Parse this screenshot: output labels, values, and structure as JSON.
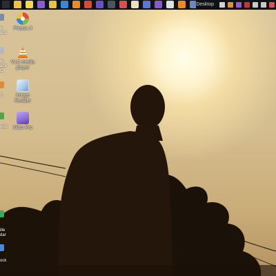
{
  "taskbar": {
    "apps": [
      {
        "icon": "windows-start-icon",
        "color": "#2a2e33"
      },
      {
        "icon": "file-explorer-icon",
        "color": "#f0c040"
      },
      {
        "icon": "sticky-notes-icon",
        "color": "#f7d84a"
      },
      {
        "icon": "visual-studio-icon",
        "color": "#8a5bd6"
      },
      {
        "icon": "chrome-icon",
        "color": "#e9c23a"
      },
      {
        "icon": "defender-shield-icon",
        "color": "#3a86d8"
      },
      {
        "icon": "vlc-icon",
        "color": "#f08a1c"
      },
      {
        "icon": "app-icon",
        "color": "#d64a3a"
      },
      {
        "icon": "media-icon",
        "color": "#6c4bd6"
      },
      {
        "icon": "store-icon",
        "color": "#4a5560"
      },
      {
        "icon": "video-icon",
        "color": "#e64a4a"
      },
      {
        "icon": "messaging-icon",
        "color": "#e8e0c0"
      },
      {
        "icon": "browser-icon",
        "color": "#5b74e0"
      },
      {
        "icon": "photos-icon",
        "color": "#8a58c8"
      },
      {
        "icon": "file-icon",
        "color": "#e0e0e0"
      },
      {
        "icon": "firefox-icon",
        "color": "#ef8a22"
      },
      {
        "icon": "settings-icon",
        "color": "#6a88c8"
      }
    ],
    "desktop_label": "Desktop",
    "tray": [
      {
        "icon": "tray-app-icon",
        "color": "#d0d0d0"
      },
      {
        "icon": "tray-orange-icon",
        "color": "#e09030"
      },
      {
        "icon": "tray-purple-icon",
        "color": "#9b59d0"
      },
      {
        "icon": "tray-red-icon",
        "color": "#d03030"
      },
      {
        "icon": "battery-icon",
        "color": "#c8c8c8"
      },
      {
        "icon": "volume-icon",
        "color": "#c8c8c8"
      },
      {
        "icon": "network-icon",
        "color": "#e05050"
      }
    ]
  },
  "desktop": {
    "icons": [
      {
        "label": "Picasa 3",
        "icon": "picasa-icon",
        "color": "#7bbf3a"
      },
      {
        "label": "VLC media player",
        "icon": "vlc-media-player-icon",
        "color": "#f08a1c"
      },
      {
        "label": "Image Resizer",
        "icon": "image-resizer-icon",
        "color": "#a8c8e8"
      },
      {
        "label": "Nitro Pro",
        "icon": "nitro-pro-icon",
        "color": "#8a6ad0"
      }
    ],
    "edge_labels": [
      "e",
      "ack",
      "er",
      "ack",
      "C",
      "5",
      "edic",
      "ille",
      "dar",
      "ock"
    ]
  }
}
